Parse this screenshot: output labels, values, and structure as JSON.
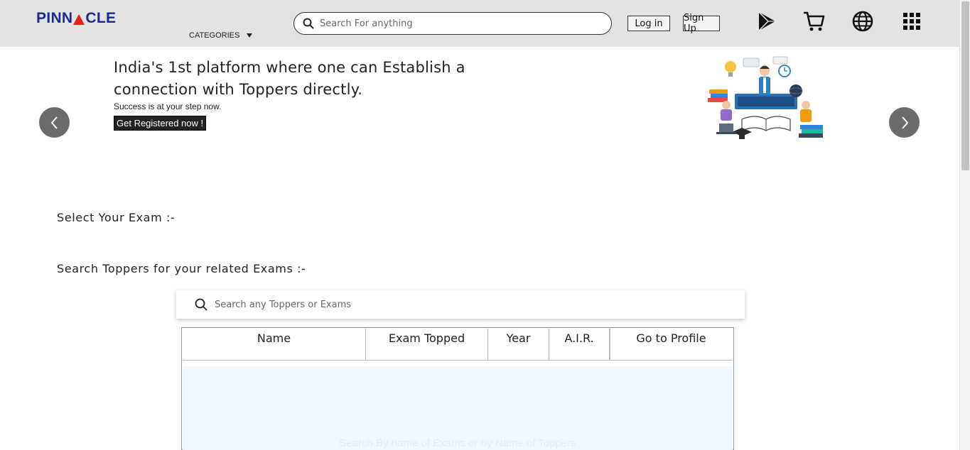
{
  "header": {
    "logo": {
      "text_before": "PINN",
      "text_after": "CLE"
    },
    "categories_label": "CATEGORIES",
    "search_placeholder": "Search For anything",
    "login_label": "Log in",
    "signup_label": "Sign Up",
    "icons": [
      "play-store-icon",
      "cart-icon",
      "globe-icon",
      "apps-grid-icon"
    ]
  },
  "hero": {
    "title": "India's 1st platform where one can Establish a connection with Toppers directly.",
    "subtitle": "Success is at your step now.",
    "cta_label": "Get Registered now !",
    "prev_icon": "chevron-left-icon",
    "next_icon": "chevron-right-icon"
  },
  "select_exam_label": "Select Your Exam :-",
  "search_toppers": {
    "label": "Search Toppers for your related Exams :-",
    "placeholder": "Search any Toppers or Exams"
  },
  "table": {
    "columns": [
      "Name",
      "Exam Topped",
      "Year",
      "A.I.R.",
      "Go to Profile"
    ],
    "empty_message": "Search By name of Exams or by Name of Toppers"
  },
  "colors": {
    "header_bg": "#e3e3e3",
    "logo_blue": "#1c2b8c",
    "logo_red": "#e2231a",
    "table_body_bg": "#f1f8ff",
    "carousel_btn": "#6b6b6b"
  }
}
